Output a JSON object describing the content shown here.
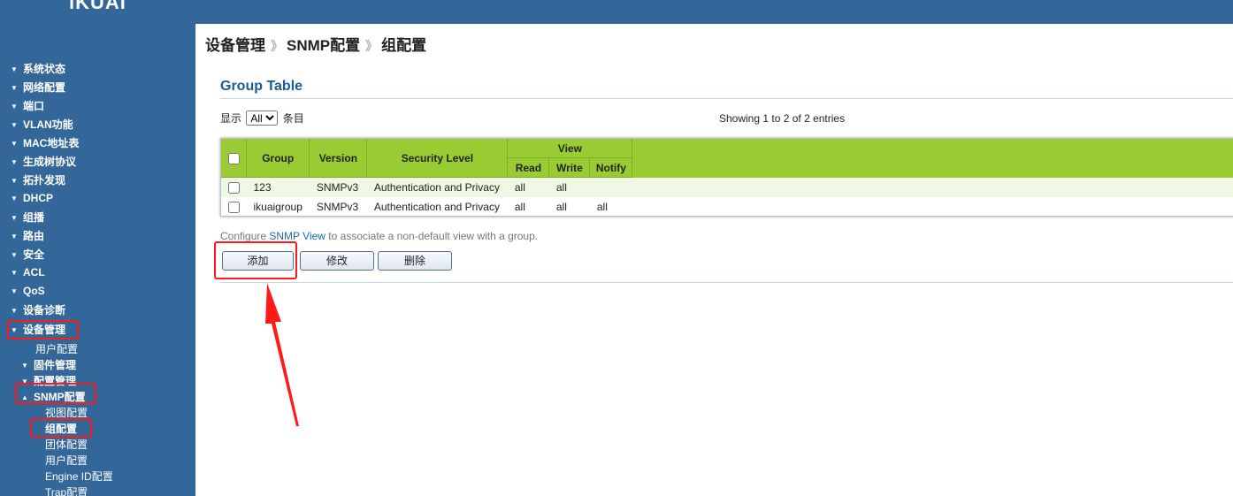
{
  "app": {
    "logo_text": "iKUAI"
  },
  "sidebar": {
    "items": [
      {
        "label": "系统状态",
        "level": 0,
        "expanded": false
      },
      {
        "label": "网络配置",
        "level": 0,
        "expanded": false
      },
      {
        "label": "端口",
        "level": 0,
        "expanded": false
      },
      {
        "label": "VLAN功能",
        "level": 0,
        "expanded": false
      },
      {
        "label": "MAC地址表",
        "level": 0,
        "expanded": false
      },
      {
        "label": "生成树协议",
        "level": 0,
        "expanded": false
      },
      {
        "label": "拓扑发现",
        "level": 0,
        "expanded": false
      },
      {
        "label": "DHCP",
        "level": 0,
        "expanded": false
      },
      {
        "label": "组播",
        "level": 0,
        "expanded": false
      },
      {
        "label": "路由",
        "level": 0,
        "expanded": false
      },
      {
        "label": "安全",
        "level": 0,
        "expanded": false
      },
      {
        "label": "ACL",
        "level": 0,
        "expanded": false
      },
      {
        "label": "QoS",
        "level": 0,
        "expanded": false
      },
      {
        "label": "设备诊断",
        "level": 0,
        "expanded": false
      },
      {
        "label": "设备管理",
        "level": 0,
        "expanded": true
      },
      {
        "label": "用户配置",
        "level": 2
      },
      {
        "label": "固件管理",
        "level": 1,
        "expanded": false
      },
      {
        "label": "配置管理",
        "level": 1,
        "expanded": false
      },
      {
        "label": "SNMP配置",
        "level": 1,
        "expanded": true
      },
      {
        "label": "视图配置",
        "level": 3
      },
      {
        "label": "组配置",
        "level": 3,
        "active": true
      },
      {
        "label": "团体配置",
        "level": 3
      },
      {
        "label": "用户配置",
        "level": 3
      },
      {
        "label": "Engine ID配置",
        "level": 3
      },
      {
        "label": "Trap配置",
        "level": 3
      }
    ]
  },
  "breadcrumb": {
    "items": [
      "设备管理",
      "SNMP配置",
      "组配置"
    ],
    "separator": "》"
  },
  "section": {
    "title": "Group Table"
  },
  "length_control": {
    "prefix": "显示",
    "selected": "All",
    "suffix": "条目"
  },
  "info": {
    "showing": "Showing 1 to 2 of 2 entries"
  },
  "table": {
    "headers": {
      "group": "Group",
      "version": "Version",
      "security_level": "Security Level",
      "view": "View",
      "read": "Read",
      "write": "Write",
      "notify": "Notify"
    },
    "rows": [
      {
        "group": "123",
        "version": "SNMPv3",
        "security_level": "Authentication and Privacy",
        "read": "all",
        "write": "all",
        "notify": ""
      },
      {
        "group": "ikuaigroup",
        "version": "SNMPv3",
        "security_level": "Authentication and Privacy",
        "read": "all",
        "write": "all",
        "notify": "all"
      }
    ]
  },
  "note": {
    "prefix": "Configure ",
    "link": "SNMP View",
    "suffix": " to associate a non-default view with a group."
  },
  "buttons": {
    "add": "添加",
    "edit": "修改",
    "delete": "删除"
  },
  "colors": {
    "sidebar_bg": "#336699",
    "table_header": "#99cc33",
    "highlight_red": "#ff1a1a",
    "title_blue": "#1e5a96"
  }
}
